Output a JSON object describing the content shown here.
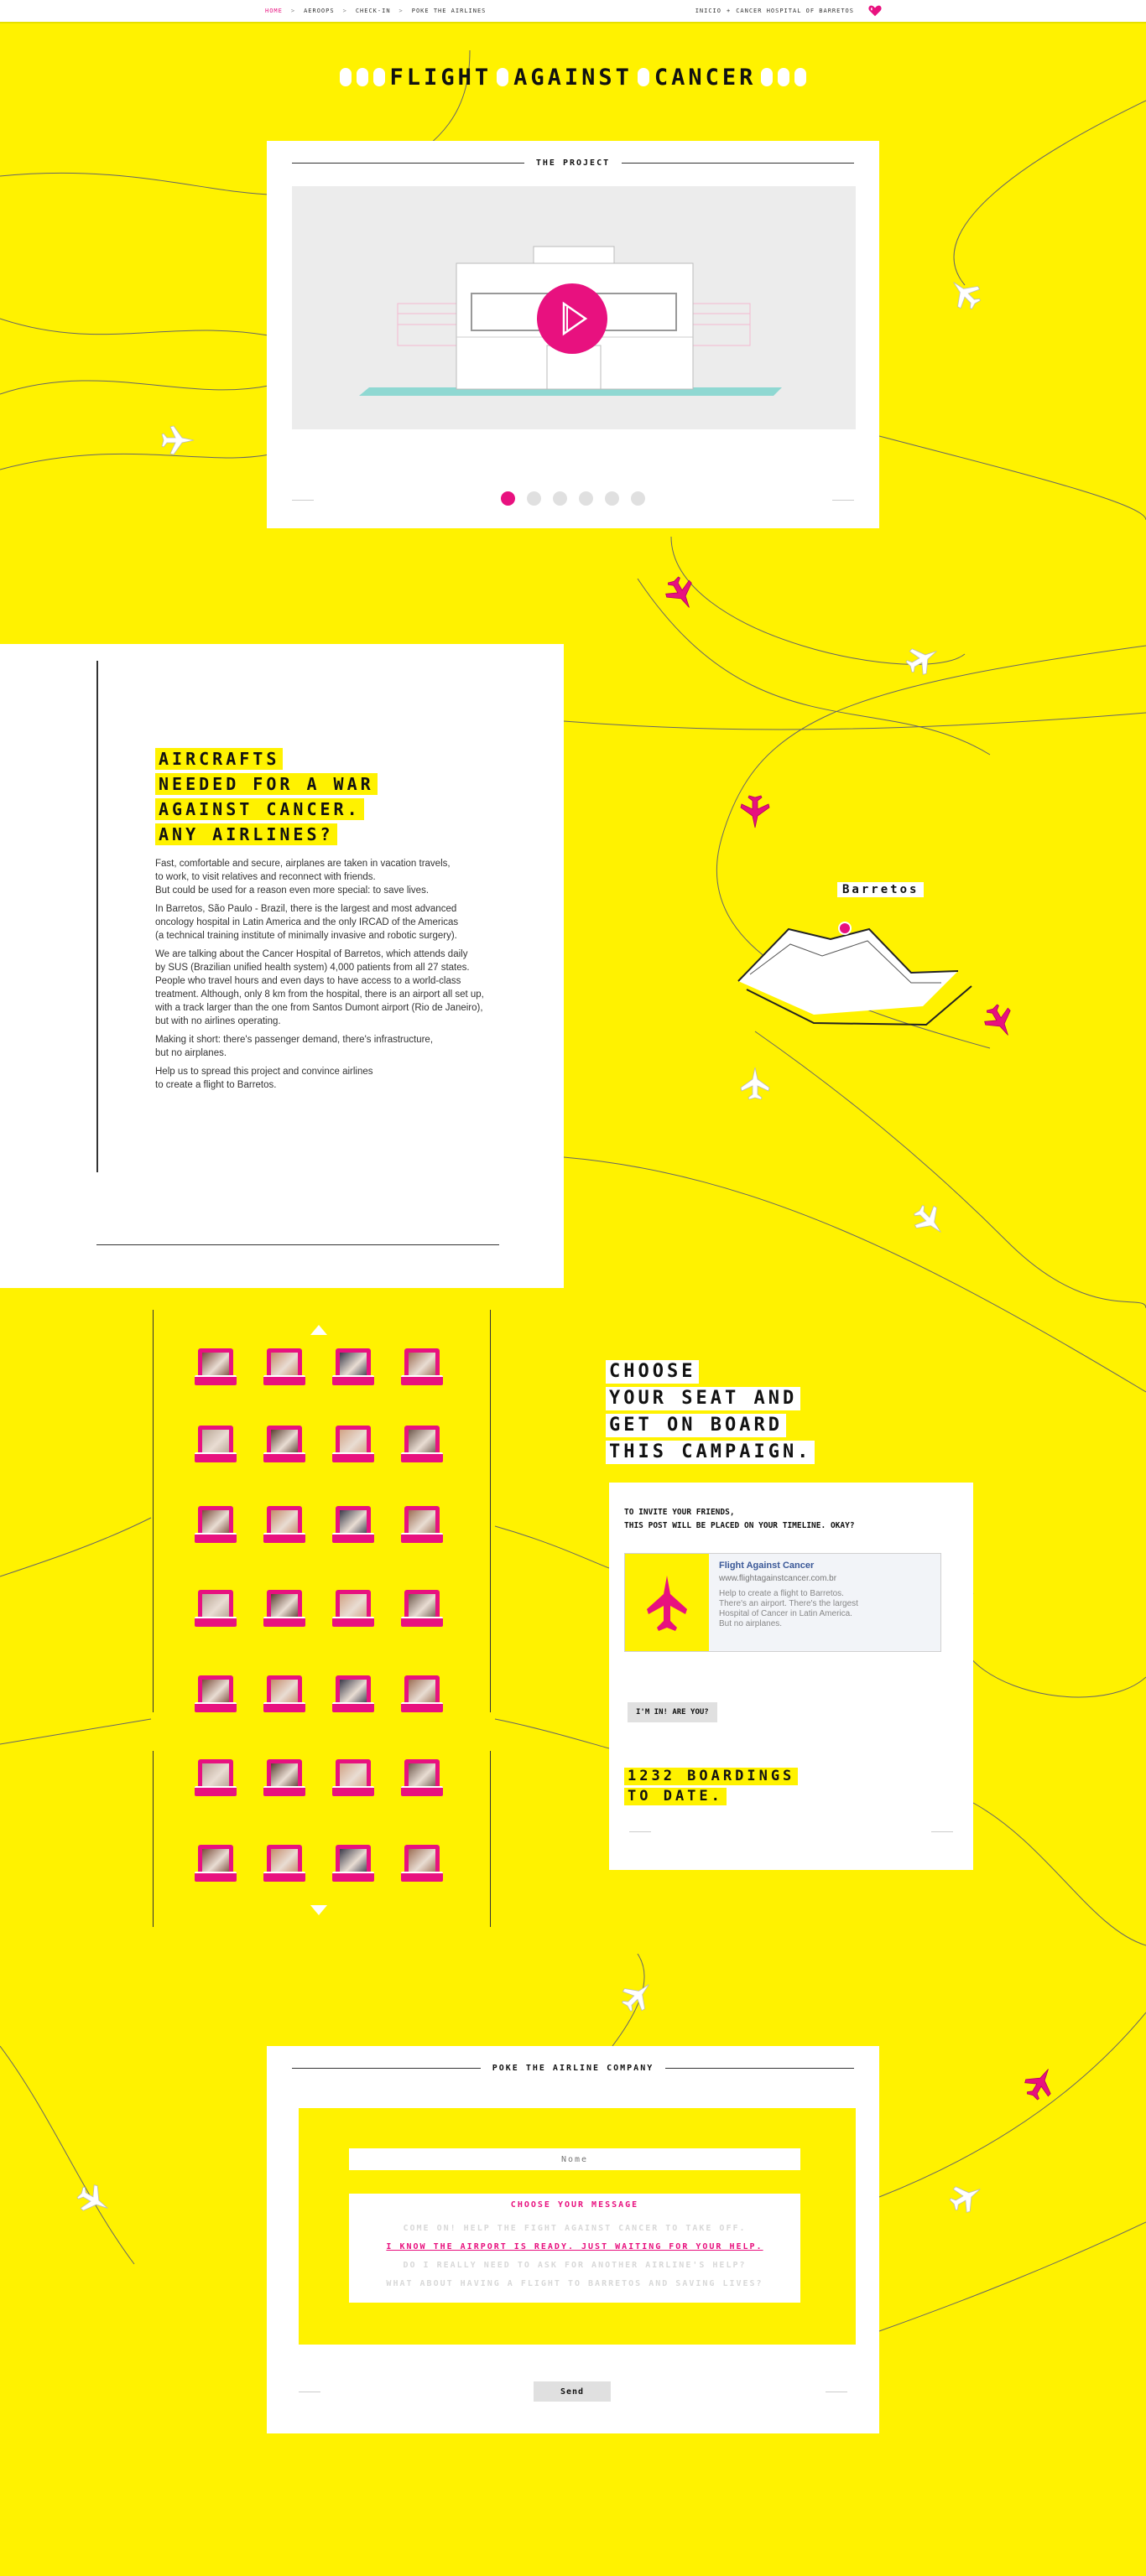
{
  "colors": {
    "background": "#fff200",
    "accent": "#e8117f",
    "card": "#ffffff",
    "text": "#111111"
  },
  "nav": {
    "items": [
      "Home",
      "Aeroops",
      "Check-in",
      "Poke the airlines"
    ],
    "separator": ">",
    "right": [
      "Inicio",
      "Cancer Hospital of Barretos"
    ],
    "right_separator": "+"
  },
  "logo": {
    "words": [
      "Flight",
      "Against",
      "Cancer"
    ]
  },
  "project": {
    "title": "The Project",
    "slides": 6,
    "active_slide": 1
  },
  "aircraft": {
    "headline": [
      "Aircrafts",
      "needed for a war",
      "against cancer.",
      "Any airlines?"
    ],
    "paragraphs": [
      [
        "Fast, comfortable and secure, airplanes are taken in vacation travels,",
        "to work, to visit relatives and reconnect with friends.",
        "But could be used for a reason even more special: to save lives."
      ],
      [
        "In Barretos, São Paulo - Brazil, there is the largest and most advanced",
        "oncology hospital in Latin America and the only IRCAD of the Americas",
        "(a technical training institute of minimally invasive and robotic surgery)."
      ],
      [
        "We are talking about the Cancer Hospital of Barretos, which attends daily",
        "by SUS (Brazilian unified health system) 4,000 patients from all 27 states.",
        "People who travel hours and even days to have access to a world-class",
        "treatment. Although, only 8 km from the hospital, there is an airport all set up,",
        "with a track larger than the one from Santos Dumont airport (Rio de Janeiro),",
        "but with no airlines operating."
      ],
      [
        "Making it short: there's passenger demand, there's infrastructure,",
        "but no airplanes."
      ],
      [
        "Help us to spread this project and convince airlines",
        "to create a flight to Barretos."
      ]
    ]
  },
  "map": {
    "label": "Barretos"
  },
  "seats": {
    "rows": 7,
    "cols": 4,
    "photo_colors": [
      "#7a4b3a",
      "#c58a6b",
      "#3a3a4a",
      "#9d6e55",
      "#b7a493",
      "#5a3d30",
      "#d1a385",
      "#6f5a4e"
    ]
  },
  "checkin": {
    "heading": [
      "Choose",
      "your seat and",
      "get on board",
      "this campaign."
    ],
    "invite_text": [
      "To invite your friends,",
      "this post will be placed on your timeline. Okay?"
    ],
    "fb_title": "Flight Against Cancer",
    "fb_url": "www.flightagainstcancer.com.br",
    "fb_desc": [
      "Help to create a flight to Barretos.",
      "There's an airport. There's the largest",
      "Hospital of Cancer in Latin America.",
      "But no airplanes."
    ],
    "in_button": "I'm in! Are you?",
    "boardings": [
      "1232 boardings",
      "to date."
    ]
  },
  "poke": {
    "title": "Poke the airline company",
    "name_placeholder": "Nome",
    "choose_title": "Choose your message",
    "messages": [
      "Come on! Help the Fight Against Cancer to take off.",
      "I know the airport is ready. Just waiting for your help.",
      "Do I really need to ask for another airline's help?",
      "What about having a flight to Barretos and saving lives?"
    ],
    "selected_message": 1,
    "send": "Send"
  }
}
